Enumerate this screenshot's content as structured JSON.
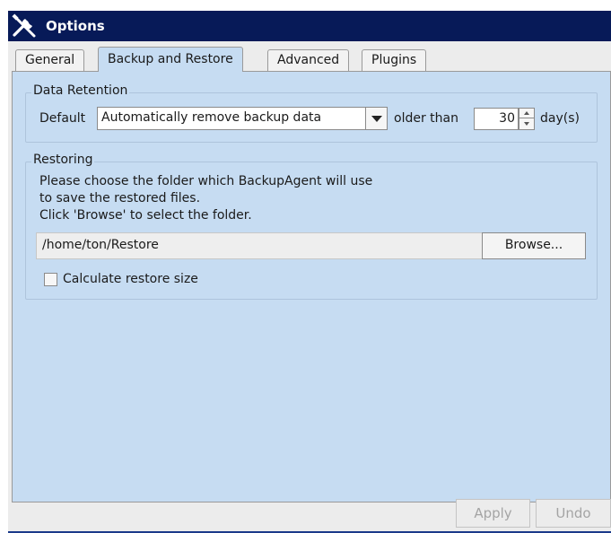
{
  "window": {
    "title": "Options",
    "title_icon": "tools-icon",
    "accent": "#071a58",
    "panel_color": "#c6dcf2"
  },
  "tabs": [
    {
      "label": "General",
      "active": false
    },
    {
      "label": "Backup and Restore",
      "active": true
    },
    {
      "label": "Advanced",
      "active": false
    },
    {
      "label": "Plugins",
      "active": false
    }
  ],
  "data_retention": {
    "title": "Data Retention",
    "default_label": "Default",
    "policy_value": "Automatically remove backup data",
    "older_than_label": "older than",
    "days_value": "30",
    "days_unit": "day(s)"
  },
  "restoring": {
    "title": "Restoring",
    "description_line1": "Please choose the folder which BackupAgent will use",
    "description_line2": "to save the restored files.",
    "description_line3": "Click 'Browse' to select the folder.",
    "path_value": "/home/ton/Restore",
    "browse_label": "Browse...",
    "calculate_size_label": "Calculate restore size",
    "calculate_size_checked": false
  },
  "footer": {
    "apply_label": "Apply",
    "undo_label": "Undo"
  }
}
